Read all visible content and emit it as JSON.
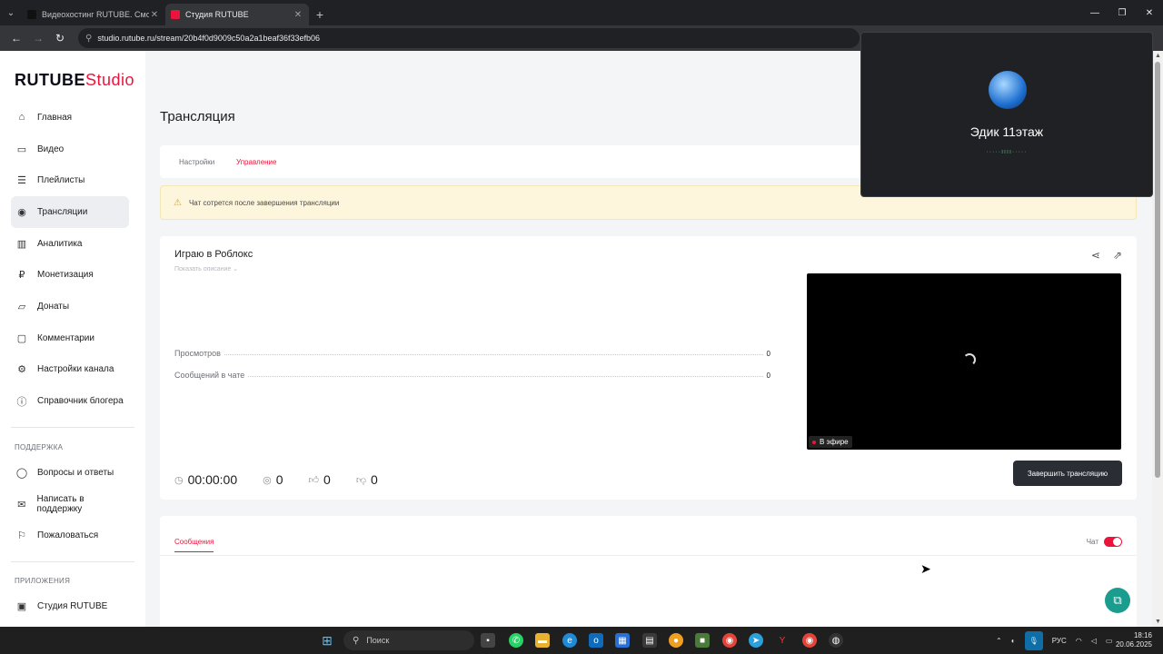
{
  "browser": {
    "tabs": [
      {
        "title": "Видеохостинг RUTUBE. Смотр",
        "active": false,
        "favicon_color": "#111111"
      },
      {
        "title": "Студия RUTUBE",
        "active": true,
        "favicon_color": "#ed143b"
      }
    ],
    "url": "studio.rutube.ru/stream/20b4f0d9009c50a2a1beaf36f33efb06"
  },
  "logo": {
    "brand": "RUTUBE",
    "product": "Studio"
  },
  "sidebar": {
    "items": [
      {
        "label": "Главная",
        "icon": "home-icon",
        "glyph": "⌂"
      },
      {
        "label": "Видео",
        "icon": "video-icon",
        "glyph": "▭"
      },
      {
        "label": "Плейлисты",
        "icon": "playlist-icon",
        "glyph": "☰"
      },
      {
        "label": "Трансляции",
        "icon": "broadcast-icon",
        "glyph": "◉"
      },
      {
        "label": "Аналитика",
        "icon": "analytics-icon",
        "glyph": "▥"
      },
      {
        "label": "Монетизация",
        "icon": "ruble-icon",
        "glyph": "₽"
      },
      {
        "label": "Донаты",
        "icon": "donate-icon",
        "glyph": "▱"
      },
      {
        "label": "Комментарии",
        "icon": "comments-icon",
        "glyph": "▢"
      },
      {
        "label": "Настройки канала",
        "icon": "gear-icon",
        "glyph": "⚙"
      },
      {
        "label": "Справочник блогера",
        "icon": "info-icon",
        "glyph": "ⓘ"
      }
    ],
    "support_title": "ПОДДЕРЖКА",
    "support_items": [
      {
        "label": "Вопросы и ответы",
        "icon": "faq-icon",
        "glyph": "◯"
      },
      {
        "label": "Написать в поддержку",
        "icon": "mail-icon",
        "glyph": "✉"
      },
      {
        "label": "Пожаловаться",
        "icon": "flag-icon",
        "glyph": "⚐"
      }
    ],
    "apps_title": "ПРИЛОЖЕНИЯ",
    "apps_items": [
      {
        "label": "Студия RUTUBE",
        "icon": "studio-icon",
        "glyph": "▣"
      }
    ]
  },
  "main": {
    "page_title": "Трансляция",
    "tabs": [
      {
        "label": "Настройки",
        "active": false
      },
      {
        "label": "Управление",
        "active": true
      }
    ],
    "warning": "Чат сотрется после завершения трансляции",
    "stream": {
      "title": "Играю в Роблокс",
      "show_description": "Показать описание ⌄",
      "stats": [
        {
          "label": "Просмотров",
          "value": "0"
        },
        {
          "label": "Сообщений в чате",
          "value": "0"
        }
      ],
      "live_label": "В эфире",
      "duration": "00:00:00",
      "viewers": "0",
      "likes": "0",
      "dislikes": "0",
      "end_button": "Завершить трансляцию"
    },
    "messages": {
      "tab_label": "Сообщения",
      "chat_label": "Чат",
      "chat_enabled": true
    }
  },
  "call_overlay": {
    "name": "Эдик 11этаж"
  },
  "taskbar": {
    "search_placeholder": "Поиск",
    "lang": "РУС",
    "time": "18:16",
    "date": "20.06.2025"
  },
  "colors": {
    "accent": "#ed143b",
    "warning_bg": "#fdf6dc",
    "fab": "#1a9c8e"
  }
}
